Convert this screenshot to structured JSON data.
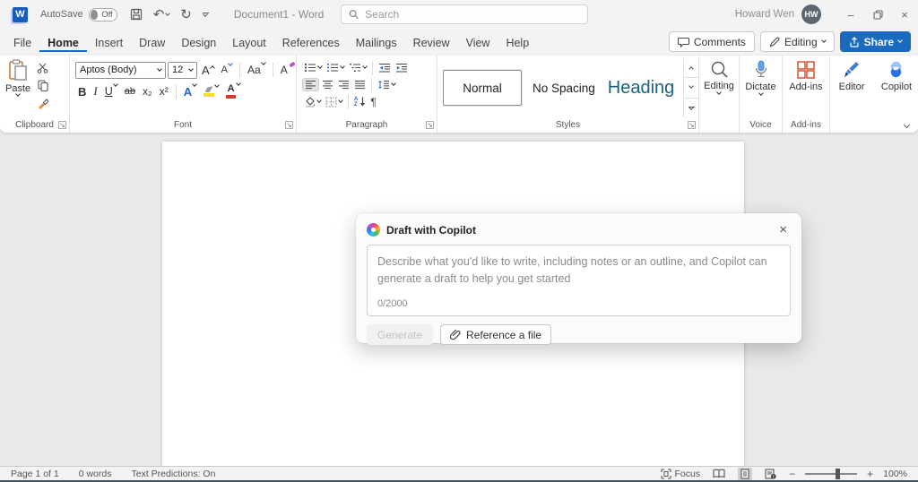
{
  "colors": {
    "accent_blue": "#1a6bc0",
    "share_blue": "#1a6bc0",
    "heading_style_teal": "#17637e",
    "addins_orange": "#d35230",
    "dictate_blue": "#4a8fe2",
    "avatar_slate": "#5b6670",
    "highlight_yellow": "#f3e11a",
    "font_color_red": "#d03a2b"
  },
  "titlebar": {
    "autosave_label": "AutoSave",
    "autosave_state": "Off",
    "document_title": "Document1  -  Word",
    "search_placeholder": "Search",
    "user_name": "Howard Wen",
    "user_initials": "HW"
  },
  "menubar": {
    "tabs": [
      "File",
      "Home",
      "Insert",
      "Draw",
      "Design",
      "Layout",
      "References",
      "Mailings",
      "Review",
      "View",
      "Help"
    ],
    "active_tab": "Home",
    "comments_label": "Comments",
    "editing_label": "Editing",
    "share_label": "Share"
  },
  "ribbon": {
    "clipboard": {
      "paste": "Paste",
      "group_label": "Clipboard"
    },
    "font": {
      "family": "Aptos (Body)",
      "size": "12",
      "grow": "A",
      "shrink": "A",
      "change_case": "Aa",
      "clear": "A",
      "bold": "B",
      "italic": "I",
      "underline": "U",
      "strikethrough": "ab",
      "subscript": "x₂",
      "superscript": "x²",
      "text_effects": "A",
      "font_color": "A",
      "group_label": "Font"
    },
    "paragraph": {
      "sort_a": "A",
      "sort_z": "Z",
      "pilcrow": "¶",
      "group_label": "Paragraph"
    },
    "styles": {
      "items": [
        "Normal",
        "No Spacing",
        "Heading"
      ],
      "selected": "Normal",
      "group_label": "Styles"
    },
    "editing": {
      "label": "Editing"
    },
    "voice": {
      "dictate": "Dictate",
      "group_label": "Voice"
    },
    "addins": {
      "label": "Add-ins",
      "group_label": "Add-ins"
    },
    "editor": {
      "label": "Editor"
    },
    "copilot": {
      "label": "Copilot"
    }
  },
  "copilot_dialog": {
    "title": "Draft with Copilot",
    "placeholder": "Describe what you'd like to write, including notes or an outline, and Copilot can generate a draft to help you get started",
    "char_counter": "0/2000",
    "generate_label": "Generate",
    "reference_label": "Reference a file"
  },
  "statusbar": {
    "page_info": "Page 1 of 1",
    "word_count": "0 words",
    "text_predictions": "Text Predictions: On",
    "focus_label": "Focus",
    "zoom_level": "100%"
  }
}
